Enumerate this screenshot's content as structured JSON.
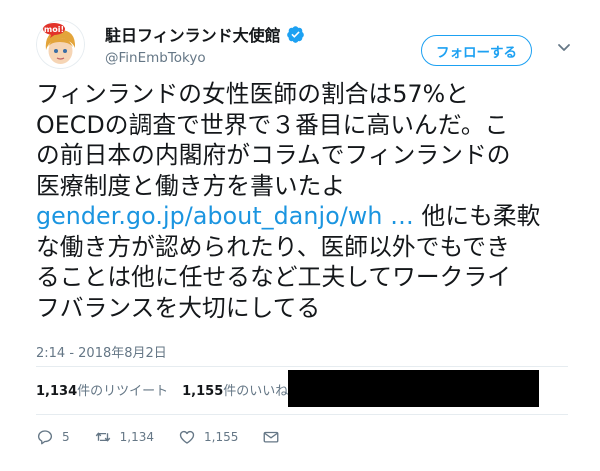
{
  "account": {
    "display_name": "駐日フィンランド大使館",
    "handle": "@FinEmbTokyo",
    "avatar_badge": "moi!",
    "verified": true
  },
  "follow_button": {
    "label": "フォローする"
  },
  "tweet": {
    "lines": [
      "フィンランドの女性医師の割合は57%と",
      "OECDの調査で世界で３番目に高いんだ。こ",
      "の前日本の内閣府がコラムでフィンランドの",
      "医療制度と働き方を書いたよ"
    ],
    "link": "gender.go.jp/about_danjo/wh …",
    "link_tail": " 他にも柔軟",
    "lines_after": [
      "な働き方が認められたり、医師以外でもでき",
      "ることは他に任せるなど工夫してワークライ",
      "フバランスを大切にしてる"
    ]
  },
  "timestamp": "2:14 - 2018年8月2日",
  "stats": {
    "retweets_count": "1,134",
    "retweets_label": "件のリツイート",
    "likes_count": "1,155",
    "likes_label": "件のいいね"
  },
  "actions": {
    "replies": "5",
    "retweets": "1,134",
    "likes": "1,155"
  },
  "colors": {
    "brand_blue": "#1da1f2",
    "link": "#1b95e0",
    "muted": "#657786",
    "divider": "#e6ecf0"
  }
}
